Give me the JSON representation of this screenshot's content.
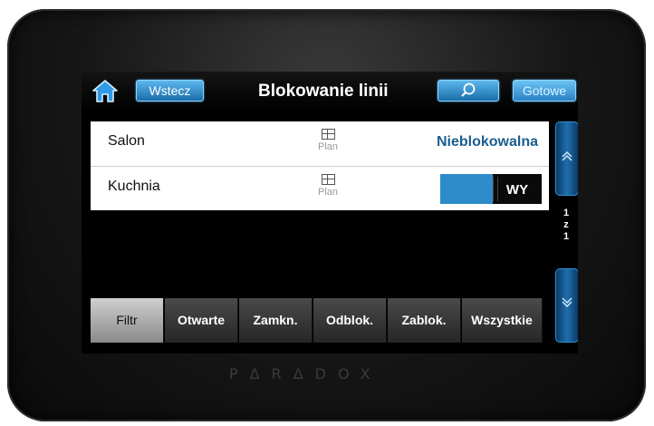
{
  "header": {
    "back_label": "Wstecz",
    "title": "Blokowanie linii",
    "done_label": "Gotowe"
  },
  "zones": [
    {
      "name": "Salon",
      "plan_label": "Plan",
      "status": "Nieblokowalna"
    },
    {
      "name": "Kuchnia",
      "plan_label": "Plan",
      "toggle_label": "WY"
    }
  ],
  "pager": {
    "current": "1",
    "separator": "z",
    "total": "1"
  },
  "filters": [
    "Filtr",
    "Otwarte",
    "Zamkn.",
    "Odblok.",
    "Zablok.",
    "Wszystkie"
  ],
  "active_filter": "Filtr",
  "brand": "PΔRΔDOX",
  "colors": {
    "accent": "#2d8cc9",
    "status_text": "#1a5e8f",
    "header_button": "#5cb6ee"
  },
  "icons": [
    "home-icon",
    "search-icon",
    "chevron-up-icon",
    "chevron-down-icon",
    "plan-icon"
  ]
}
